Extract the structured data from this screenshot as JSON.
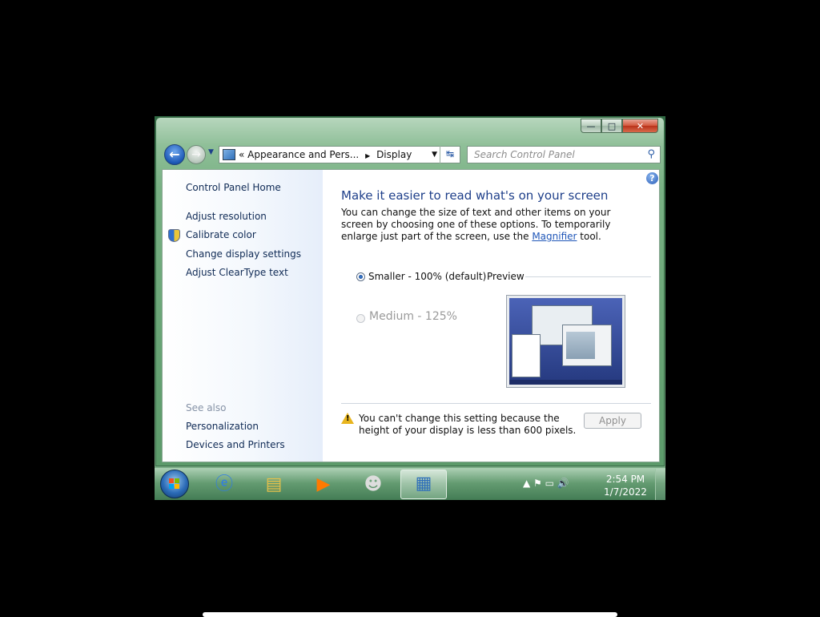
{
  "window": {
    "minimize_label": "—",
    "maximize_label": "□",
    "close_label": "✕"
  },
  "nav": {
    "back_glyph": "←",
    "forward_glyph": "→",
    "history_glyph": "▼",
    "address": {
      "prefix": "«",
      "crumb1": "Appearance and Pers...",
      "sep": "▶",
      "crumb2": "Display",
      "dropdown": "▼",
      "refresh": "↹"
    },
    "search_placeholder": "Search Control Panel",
    "search_glyph": "⚲"
  },
  "sidebar": {
    "home": "Control Panel Home",
    "links": [
      "Adjust resolution",
      "Calibrate color",
      "Change display settings",
      "Adjust ClearType text"
    ],
    "see_also_label": "See also",
    "see_also": [
      "Personalization",
      "Devices and Printers"
    ]
  },
  "main": {
    "help": "?",
    "heading": "Make it easier to read what's on your screen",
    "desc_before": "You can change the size of text and other items on your screen by choosing one of these options. To temporarily enlarge just part of the screen, use the ",
    "desc_link": "Magnifier",
    "desc_after": " tool.",
    "options": [
      {
        "label": "Smaller - 100% (default)",
        "selected": true,
        "enabled": true
      },
      {
        "label": "Medium - 125%",
        "selected": false,
        "enabled": false
      }
    ],
    "preview_label": "Preview",
    "warning": "You can't change this setting because the height of your display is less than 600 pixels.",
    "apply_label": "Apply"
  },
  "taskbar": {
    "apps": [
      "internet-explorer",
      "windows-explorer",
      "media-player",
      "raccoon-app",
      "display-control-panel"
    ],
    "tray_glyphs": "▲ ⚑ ▭ 🔊",
    "time": "2:54 PM",
    "date": "1/7/2022"
  }
}
